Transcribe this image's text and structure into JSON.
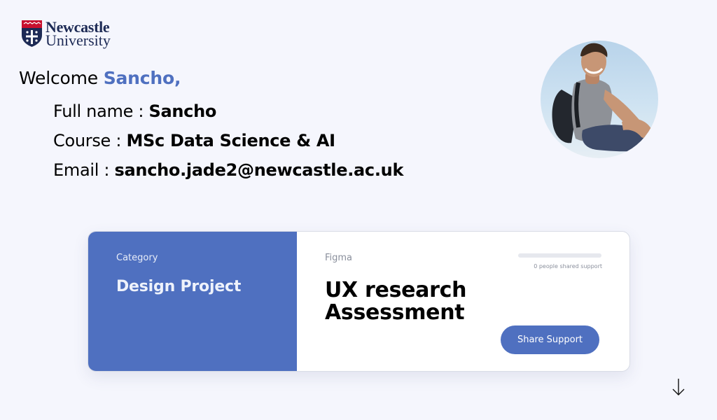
{
  "logo": {
    "line1": "Newcastle",
    "line2": "University"
  },
  "welcome": {
    "greeting": "Welcome ",
    "name": "Sancho,"
  },
  "profile": {
    "fullname_label": "Full name : ",
    "fullname_value": "Sancho",
    "course_label": "Course : ",
    "course_value": "MSc Data Science & AI",
    "email_label": "Email : ",
    "email_value": "sancho.jade2@newcastle.ac.uk"
  },
  "card": {
    "category_label": "Category",
    "category_value": "Design Project",
    "tool_label": "Figma",
    "title_line1": "UX research",
    "title_line2": "Assessment",
    "support_progress": 0,
    "support_text": "0 people shared support",
    "share_button": "Share Support"
  },
  "icons": {
    "scroll": "arrow-down-icon"
  },
  "colors": {
    "accent": "#4f70c0",
    "background": "#f5f6fd",
    "brand_navy": "#1d2a55",
    "brand_red": "#c8102e"
  }
}
